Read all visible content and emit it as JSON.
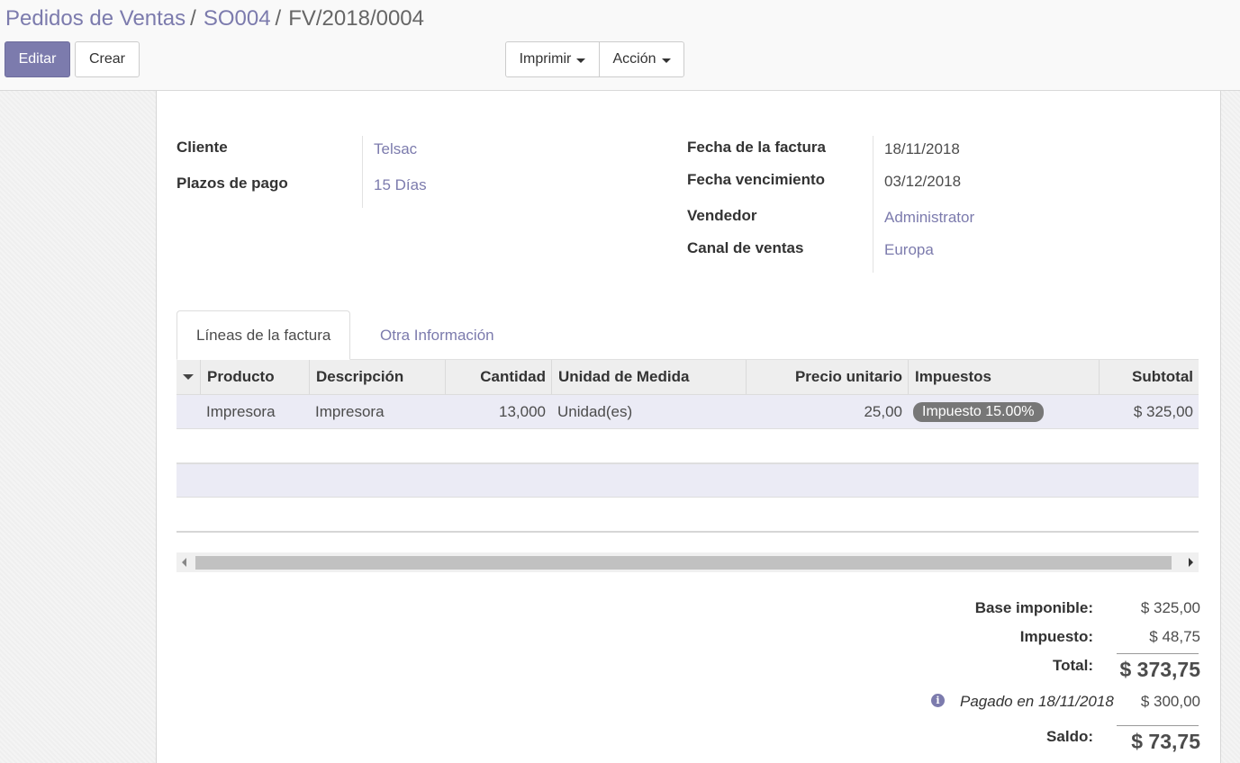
{
  "breadcrumb": [
    {
      "label": "Pedidos de Ventas"
    },
    {
      "label": "SO004"
    },
    {
      "label": "FV/2018/0004"
    }
  ],
  "breadcrumb_separator": "/",
  "buttons": {
    "edit": "Editar",
    "create": "Crear",
    "print": "Imprimir",
    "action": "Acción"
  },
  "fields_left": [
    {
      "label": "Cliente",
      "value": "Telsac"
    },
    {
      "label": "Plazos de pago",
      "value": "15 Días"
    }
  ],
  "fields_right": [
    {
      "label": "Fecha de la factura",
      "value": "18/11/2018"
    },
    {
      "label": "Fecha vencimiento",
      "value": "03/12/2018"
    },
    {
      "label": "Vendedor",
      "value": "Administrator"
    },
    {
      "label": "Canal de ventas",
      "value": "Europa"
    }
  ],
  "tabs": [
    {
      "label": "Líneas de la factura",
      "active": true
    },
    {
      "label": "Otra Información",
      "active": false
    }
  ],
  "table": {
    "columns": [
      "Producto",
      "Descripción",
      "Cantidad",
      "Unidad de Medida",
      "Precio unitario",
      "Impuestos",
      "Subtotal"
    ],
    "rows": [
      {
        "producto": "Impresora",
        "descripcion": "Impresora",
        "cantidad": "13,000",
        "unidad": "Unidad(es)",
        "precio": "25,00",
        "impuestos": "Impuesto 15.00%",
        "subtotal": "$ 325,00"
      }
    ]
  },
  "totals": {
    "base_label": "Base imponible:",
    "base_value": "$ 325,00",
    "tax_label": "Impuesto:",
    "tax_value": "$ 48,75",
    "total_label": "Total:",
    "total_value": "$ 373,75",
    "paid_text": "Pagado en 18/11/2018",
    "paid_value": "$ 300,00",
    "balance_label": "Saldo:",
    "balance_value": "$ 73,75"
  },
  "colors": {
    "brand": "#7c7bad",
    "row_highlight": "#ebebf5",
    "badge": "#777777"
  },
  "icons": {
    "sort": "caret-down-icon",
    "dropdown": "caret-down-icon",
    "info": "info-circle-icon"
  }
}
